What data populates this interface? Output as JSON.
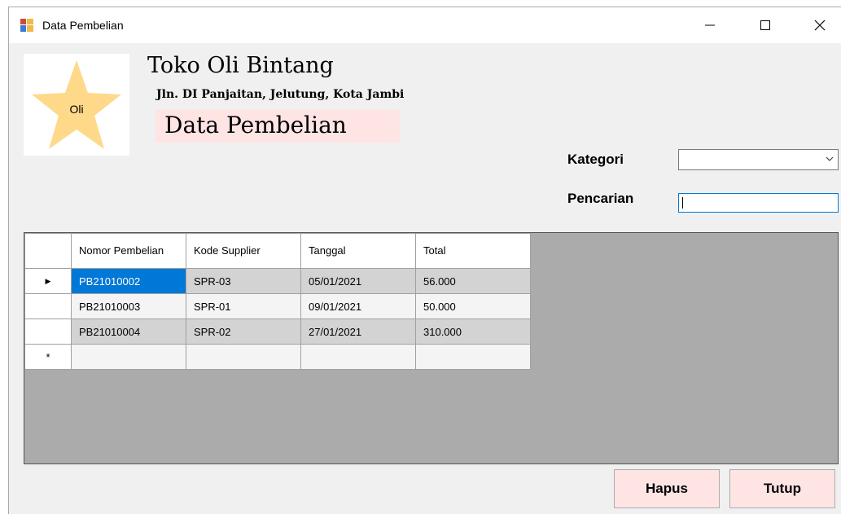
{
  "window": {
    "title": "Data Pembelian"
  },
  "header": {
    "logo_text": "Oli",
    "shop_name": "Toko Oli Bintang",
    "address": "Jln. DI Panjaitan, Jelutung, Kota Jambi",
    "page_title": "Data Pembelian"
  },
  "filters": {
    "kategori_label": "Kategori",
    "kategori_value": "",
    "pencarian_label": "Pencarian",
    "pencarian_value": ""
  },
  "table": {
    "columns": [
      "Nomor Pembelian",
      "Kode Supplier",
      "Tanggal",
      "Total"
    ],
    "rows": [
      [
        "PB21010002",
        "SPR-03",
        "05/01/2021",
        "56.000"
      ],
      [
        "PB21010003",
        "SPR-01",
        "09/01/2021",
        "50.000"
      ],
      [
        "PB21010004",
        "SPR-02",
        "27/01/2021",
        "310.000"
      ]
    ],
    "current_row_marker": "▶",
    "new_row_marker": "*"
  },
  "buttons": {
    "hapus": "Hapus",
    "tutup": "Tutup"
  },
  "colors": {
    "banner": "#ffe4e4",
    "button": "#ffe4e4",
    "star": "#ffd98a",
    "selection": "#0078d7",
    "grid_background": "#ababab"
  },
  "icons": {
    "app": "form-icon",
    "minimize": "minimize-icon",
    "maximize": "maximize-icon",
    "close": "close-icon",
    "dropdown": "chevron-down-icon",
    "logo": "star-icon"
  }
}
